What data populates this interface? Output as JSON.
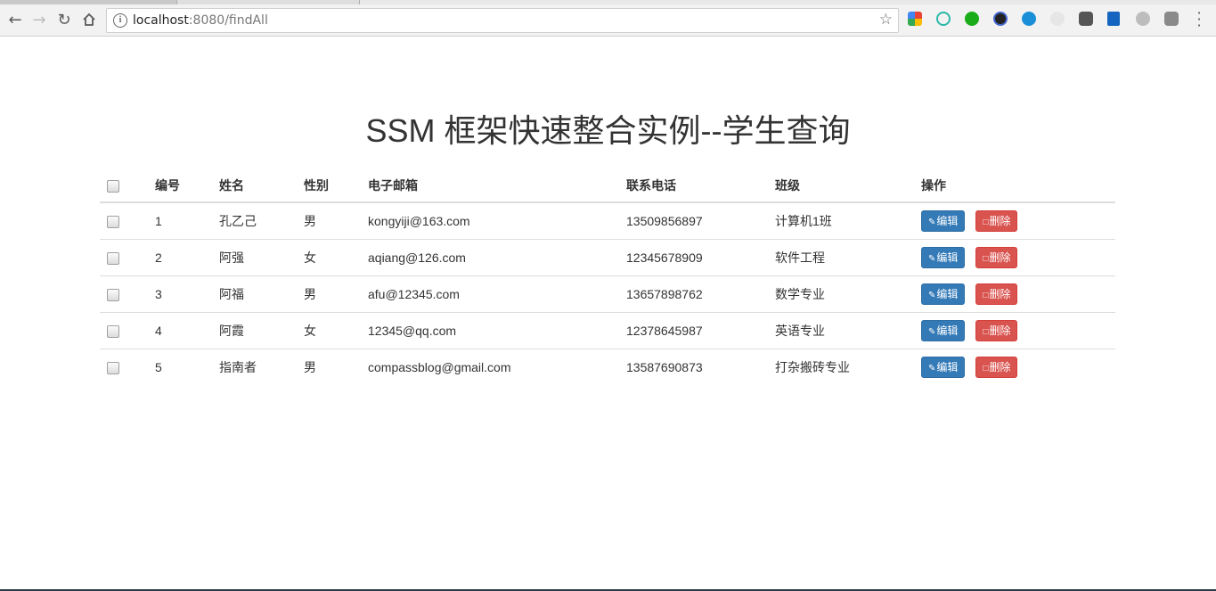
{
  "browser": {
    "url_host": "localhost",
    "url_rest": ":8080/findAll"
  },
  "page": {
    "title": "SSM 框架快速整合实例--学生查询"
  },
  "table": {
    "columns": [
      "编号",
      "姓名",
      "性别",
      "电子邮箱",
      "联系电话",
      "班级",
      "操作"
    ],
    "rows": [
      {
        "id": "1",
        "name": "孔乙己",
        "gender": "男",
        "email": "kongyiji@163.com",
        "phone": "13509856897",
        "class": "计算机1班"
      },
      {
        "id": "2",
        "name": "阿强",
        "gender": "女",
        "email": "aqiang@126.com",
        "phone": "12345678909",
        "class": "软件工程"
      },
      {
        "id": "3",
        "name": "阿福",
        "gender": "男",
        "email": "afu@12345.com",
        "phone": "13657898762",
        "class": "数学专业"
      },
      {
        "id": "4",
        "name": "阿霞",
        "gender": "女",
        "email": "12345@qq.com",
        "phone": "12378645987",
        "class": "英语专业"
      },
      {
        "id": "5",
        "name": "指南者",
        "gender": "男",
        "email": "compassblog@gmail.com",
        "phone": "13587690873",
        "class": "打杂搬砖专业"
      }
    ],
    "edit_label": "编辑",
    "delete_label": "删除"
  },
  "colors": {
    "edit_button": "#337ab7",
    "delete_button": "#d9534f"
  },
  "icons": {
    "edit": "pencil-icon",
    "delete": "trash-icon"
  }
}
